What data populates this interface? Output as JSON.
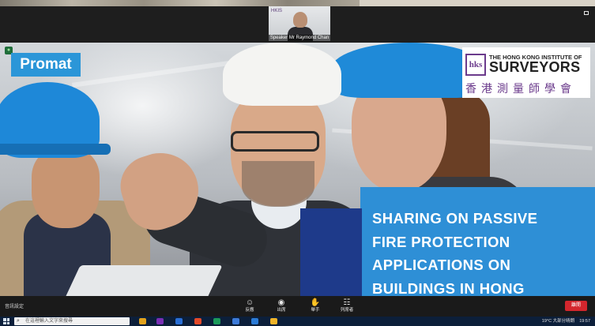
{
  "meeting": {
    "speaker_tile": {
      "name": "Speaker Mr Raymond Chan",
      "logo_text": "HKIS"
    },
    "view_label": "▦"
  },
  "slide": {
    "brand": "Promat",
    "institute": {
      "en_line1": "THE HONG KONG INSTITUTE OF",
      "en_line2": "SURVEYORS",
      "zh": "香港測量師學會",
      "crest": "hks"
    },
    "headline_lines": [
      "SHARING ON PASSIVE",
      "FIRE PROTECTION",
      "APPLICATIONS ON",
      "BUILDINGS IN HONG"
    ]
  },
  "toolbar": {
    "left_label": "音訊設定",
    "items": [
      {
        "icon": "☺",
        "label": "反應"
      },
      {
        "icon": "◉",
        "label": "出席"
      },
      {
        "icon": "✋",
        "label": "舉手"
      },
      {
        "icon": "☷",
        "label": "列席者"
      }
    ],
    "end_label": "離開"
  },
  "taskbar": {
    "search_placeholder": "在這裡輸入文字來搜尋",
    "weather": "19°C 大部分晴朗",
    "time": "19:57",
    "colors": {
      "bg": "#0c1f3a",
      "apps": [
        "#e2a21c",
        "#7a2fb5",
        "#2a6fd6",
        "#e34a2a",
        "#1b9a5a",
        "#3d7bd9",
        "#2b7bd6",
        "#f0b429"
      ]
    }
  }
}
